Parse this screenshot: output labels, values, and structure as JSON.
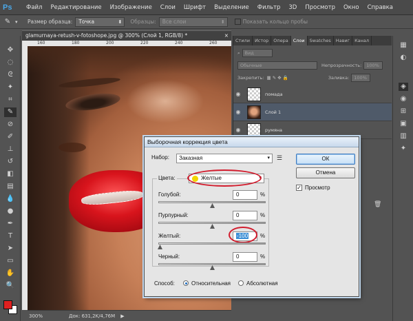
{
  "app": {
    "logo": "Ps"
  },
  "menu": [
    "Файл",
    "Редактирование",
    "Изображение",
    "Слои",
    "Шрифт",
    "Выделение",
    "Фильтр",
    "3D",
    "Просмотр",
    "Окно",
    "Справка"
  ],
  "options": {
    "sample_size_label": "Размер образца:",
    "sample_size_value": "Точка",
    "samples_label": "Образцы:",
    "samples_value": "Все слои",
    "show_ring_label": "Показать кольцо пробы"
  },
  "document": {
    "tab_title": "glamurnaya-retush-v-fotoshope.jpg @ 300% (Слой 1, RGB/8) *",
    "close": "×",
    "ruler_ticks": [
      "160",
      "180",
      "200",
      "220",
      "240",
      "260"
    ],
    "zoom": "300%",
    "doc_info": "Док: 631,2K/4,76M"
  },
  "panel": {
    "tabs": [
      "Стили",
      "Истор",
      "Опера",
      "Слои",
      "Swatches",
      "Навиг",
      "Канал"
    ],
    "active_tab": "Слои",
    "kind_label": "Вид",
    "blend_mode": "Обычные",
    "opacity_label": "Непрозрачность:",
    "opacity_value": "100%",
    "lock_label": "Закрепить:",
    "fill_label": "Заливка:",
    "fill_value": "100%",
    "layers": [
      {
        "name": "помада",
        "selected": false
      },
      {
        "name": "Слой 1",
        "selected": true
      },
      {
        "name": "румяна",
        "selected": false
      }
    ]
  },
  "dialog": {
    "title": "Выборочная коррекция цвета",
    "preset_label": "Набор:",
    "preset_value": "Заказная",
    "colors_label": "Цвета:",
    "colors_value": "Желтые",
    "ok_label": "ОК",
    "cancel_label": "Отмена",
    "preview_label": "Просмотр",
    "preview_checked": "✓",
    "sliders": [
      {
        "label": "Голубой:",
        "value": "0",
        "unit": "%",
        "level": 0
      },
      {
        "label": "Пурпурный:",
        "value": "0",
        "unit": "%",
        "level": 0
      },
      {
        "label": "Желтый:",
        "value": "-100",
        "unit": "%",
        "level": -100
      },
      {
        "label": "Черный:",
        "value": "0",
        "unit": "%",
        "level": 0
      }
    ],
    "method_label": "Способ:",
    "method_relative": "Относительная",
    "method_absolute": "Абсолютная",
    "selected_method": "Относительная"
  },
  "colors": {
    "accent": "#3b8fd6",
    "highlight_ring": "#d21c2d",
    "yellow_swatch": "#f2d600",
    "foreground": "#e02020",
    "background": "#ffffff"
  }
}
